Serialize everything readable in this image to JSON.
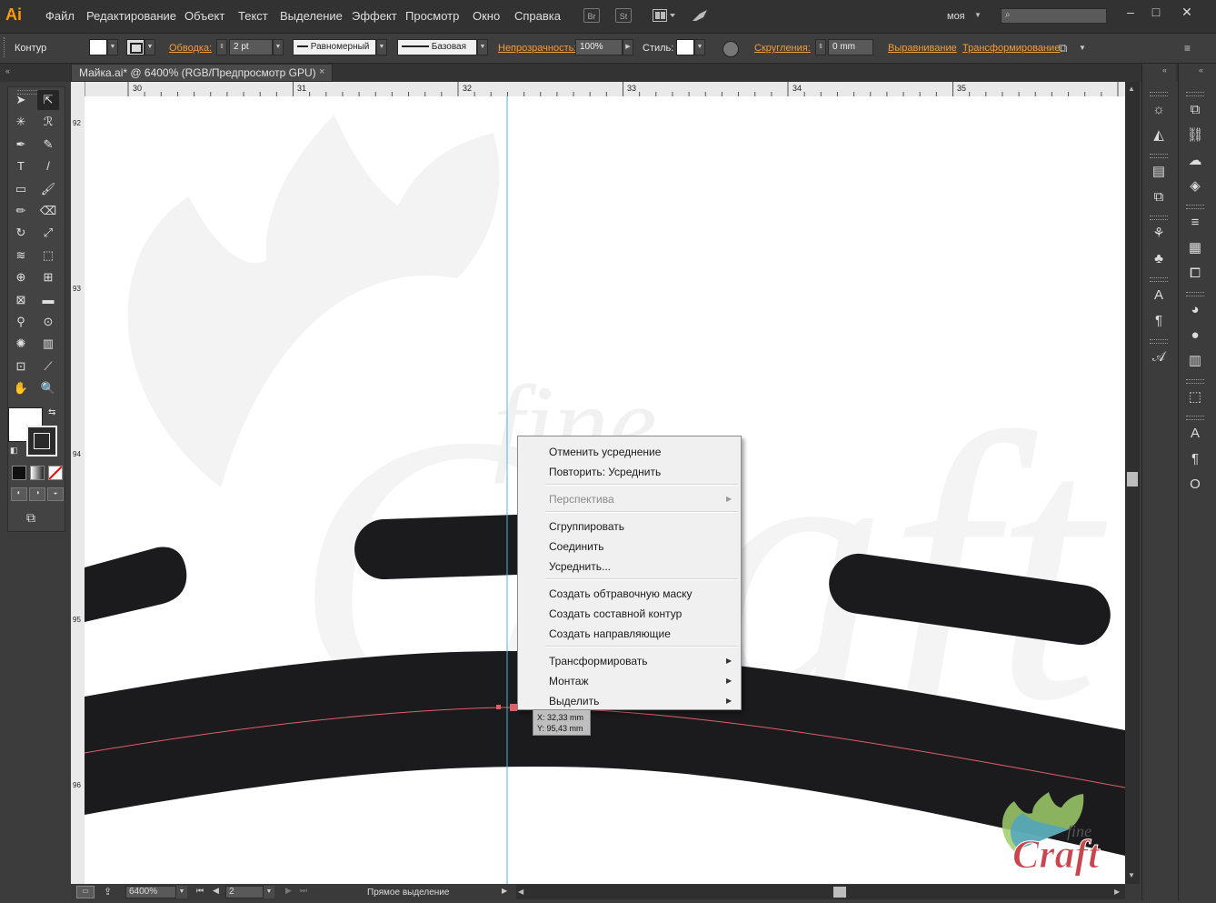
{
  "app": {
    "logo": "Ai"
  },
  "menubar": {
    "items": [
      "Файл",
      "Редактирование",
      "Объект",
      "Текст",
      "Выделение",
      "Эффект",
      "Просмотр",
      "Окно",
      "Справка"
    ],
    "icons": {
      "bridge": "Br",
      "stock": "St"
    },
    "workspace": "моя",
    "window_controls": [
      "–",
      "□",
      "✕"
    ]
  },
  "controlbar": {
    "selection_type": "Контур",
    "stroke_link": "Обводка:",
    "stroke_weight": "2 pt",
    "profile": "Равномерный",
    "brush": "Базовая",
    "opacity_link": "Непрозрачность:",
    "opacity_value": "100%",
    "style_label": "Стиль:",
    "corners_link": "Скругления:",
    "corners_value": "0 mm",
    "align_link": "Выравнивание",
    "transform_link": "Трансформирование"
  },
  "document_tab": {
    "title": "Майка.ai* @ 6400% (RGB/Предпросмотр GPU)",
    "close": "×"
  },
  "rulers": {
    "horizontal": [
      "30",
      "31",
      "32",
      "33",
      "34",
      "35"
    ],
    "vertical": [
      "92",
      "93",
      "94",
      "95",
      "96"
    ]
  },
  "context_menu": {
    "items": [
      {
        "label": "Отменить усреднение",
        "disabled": false,
        "submenu": false
      },
      {
        "label": "Повторить: Усреднить",
        "disabled": false,
        "submenu": false
      },
      {
        "separator": true
      },
      {
        "label": "Перспектива",
        "disabled": true,
        "submenu": true
      },
      {
        "separator": true
      },
      {
        "label": "Сгруппировать",
        "disabled": false,
        "submenu": false
      },
      {
        "label": "Соединить",
        "disabled": false,
        "submenu": false
      },
      {
        "label": "Усреднить...",
        "disabled": false,
        "submenu": false
      },
      {
        "separator": true
      },
      {
        "label": "Создать обтравочную маску",
        "disabled": false,
        "submenu": false
      },
      {
        "label": "Создать составной контур",
        "disabled": false,
        "submenu": false
      },
      {
        "label": "Создать направляющие",
        "disabled": false,
        "submenu": false
      },
      {
        "separator": true
      },
      {
        "label": "Трансформировать",
        "disabled": false,
        "submenu": true
      },
      {
        "label": "Монтаж",
        "disabled": false,
        "submenu": true
      },
      {
        "label": "Выделить",
        "disabled": false,
        "submenu": true
      }
    ]
  },
  "tooltip": {
    "x": "X: 32,33 mm",
    "y": "Y: 95,43 mm"
  },
  "statusbar": {
    "zoom": "6400%",
    "artboard": "2",
    "tool": "Прямое выделение"
  },
  "watermark": {
    "brand_top": "fine",
    "brand_bottom": "Craft"
  },
  "colors": {
    "accent_orange": "#ff9a00",
    "link_orange": "#f39c3c",
    "shape_fill": "#1b1a1c",
    "path_selection": "#e0606a",
    "guide": "#4fb6d8",
    "watermark": "#f4f4f4",
    "logo_red": "#c8474f"
  },
  "icons": {
    "tools": [
      "selection-tool-icon",
      "direct-selection-tool-icon",
      "magic-wand-icon",
      "lasso-icon",
      "pen-tool-icon",
      "curvature-tool-icon",
      "type-tool-icon",
      "line-tool-icon",
      "rectangle-tool-icon",
      "paintbrush-icon",
      "pencil-icon",
      "eraser-icon",
      "rotate-tool-icon",
      "scale-tool-icon",
      "width-tool-icon",
      "free-transform-icon",
      "shape-builder-icon",
      "perspective-grid-icon",
      "mesh-tool-icon",
      "gradient-tool-icon",
      "eyedropper-icon",
      "blend-tool-icon",
      "symbol-sprayer-icon",
      "column-graph-icon",
      "artboard-tool-icon",
      "slice-tool-icon",
      "hand-tool-icon",
      "zoom-tool-icon"
    ]
  }
}
